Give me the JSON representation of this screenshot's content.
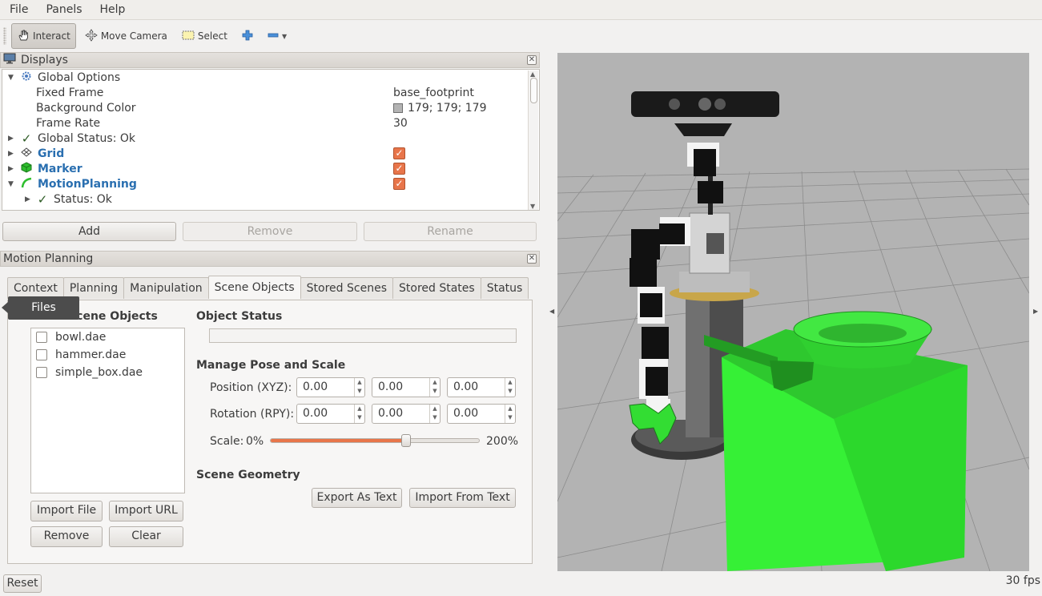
{
  "menu": [
    "File",
    "Panels",
    "Help"
  ],
  "toolbar": {
    "interact": "Interact",
    "move_camera": "Move Camera",
    "select": "Select"
  },
  "displays": {
    "title": "Displays",
    "rows": {
      "global_options": "Global Options",
      "fixed_frame": "Fixed Frame",
      "fixed_frame_val": "base_footprint",
      "bg_color": "Background Color",
      "bg_color_val": "179; 179; 179",
      "frame_rate": "Frame Rate",
      "frame_rate_val": "30",
      "global_status": "Global Status: Ok",
      "grid": "Grid",
      "marker": "Marker",
      "motion_planning": "MotionPlanning",
      "status_ok": "Status: Ok"
    },
    "buttons": {
      "add": "Add",
      "remove": "Remove",
      "rename": "Rename"
    },
    "colors": {
      "checkbox": "#e8754a",
      "plugin_name": "#2a6fb0"
    }
  },
  "motion_planning": {
    "title": "Motion Planning",
    "tabs": [
      "Context",
      "Planning",
      "Manipulation",
      "Scene Objects",
      "Stored Scenes",
      "Stored States",
      "Status"
    ],
    "selected_tab": "Scene Objects",
    "tooltip": "Files",
    "current_scene_objects": "Current Scene Objects",
    "objects": [
      "bowl.dae",
      "hammer.dae",
      "simple_box.dae"
    ],
    "buttons": {
      "import_file": "Import File",
      "import_url": "Import URL",
      "remove": "Remove",
      "clear": "Clear",
      "export_text": "Export As Text",
      "import_text": "Import From Text"
    },
    "object_status": "Object Status",
    "manage_pose": "Manage Pose and Scale",
    "position_label": "Position (XYZ):",
    "rotation_label": "Rotation (RPY):",
    "position": [
      "0.00",
      "0.00",
      "0.00"
    ],
    "rotation": [
      "0.00",
      "0.00",
      "0.00"
    ],
    "scale_label": "Scale:",
    "scale_min": "0%",
    "scale_max": "200%",
    "scale_position": 0.65,
    "scene_geometry": "Scene Geometry"
  },
  "viewport": {
    "background": "#b3b3b3",
    "object_color": "#33ff33"
  },
  "bottom": {
    "reset": "Reset",
    "fps": "30 fps"
  }
}
